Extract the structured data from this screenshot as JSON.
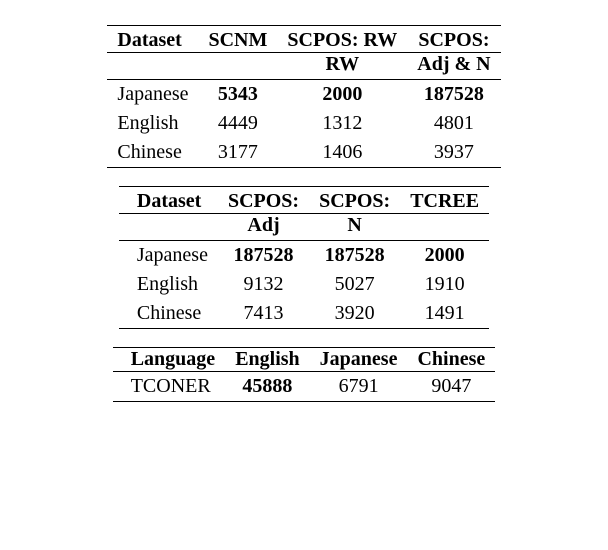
{
  "table1": {
    "headers": [
      "Dataset",
      "SCNM",
      "SCPOS: RW",
      "SCPOS:"
    ],
    "subheaders": [
      "",
      "",
      "RW",
      "Adj & N"
    ],
    "rows": [
      {
        "label": "Japanese",
        "c1": "5343",
        "c2": "2000",
        "c3": "187528",
        "bold": true
      },
      {
        "label": "English",
        "c1": "4449",
        "c2": "1312",
        "c3": "4801",
        "bold": false
      },
      {
        "label": "Chinese",
        "c1": "3177",
        "c2": "1406",
        "c3": "3937",
        "bold": false
      }
    ]
  },
  "table2": {
    "headers": [
      "Dataset",
      "SCPOS:",
      "SCPOS:",
      "TCREE"
    ],
    "subheaders": [
      "",
      "Adj",
      "N",
      ""
    ],
    "rows": [
      {
        "label": "Japanese",
        "c1": "187528",
        "c2": "187528",
        "c3": "2000",
        "bold": true
      },
      {
        "label": "English",
        "c1": "9132",
        "c2": "5027",
        "c3": "1910",
        "bold": false
      },
      {
        "label": "Chinese",
        "c1": "7413",
        "c2": "3920",
        "c3": "1491",
        "bold": false
      }
    ]
  },
  "table3": {
    "headers": [
      "Language",
      "English",
      "Japanese",
      "Chinese"
    ],
    "row": {
      "label": "TCONER",
      "c1": "45888",
      "c2": "6791",
      "c3": "9047"
    }
  }
}
